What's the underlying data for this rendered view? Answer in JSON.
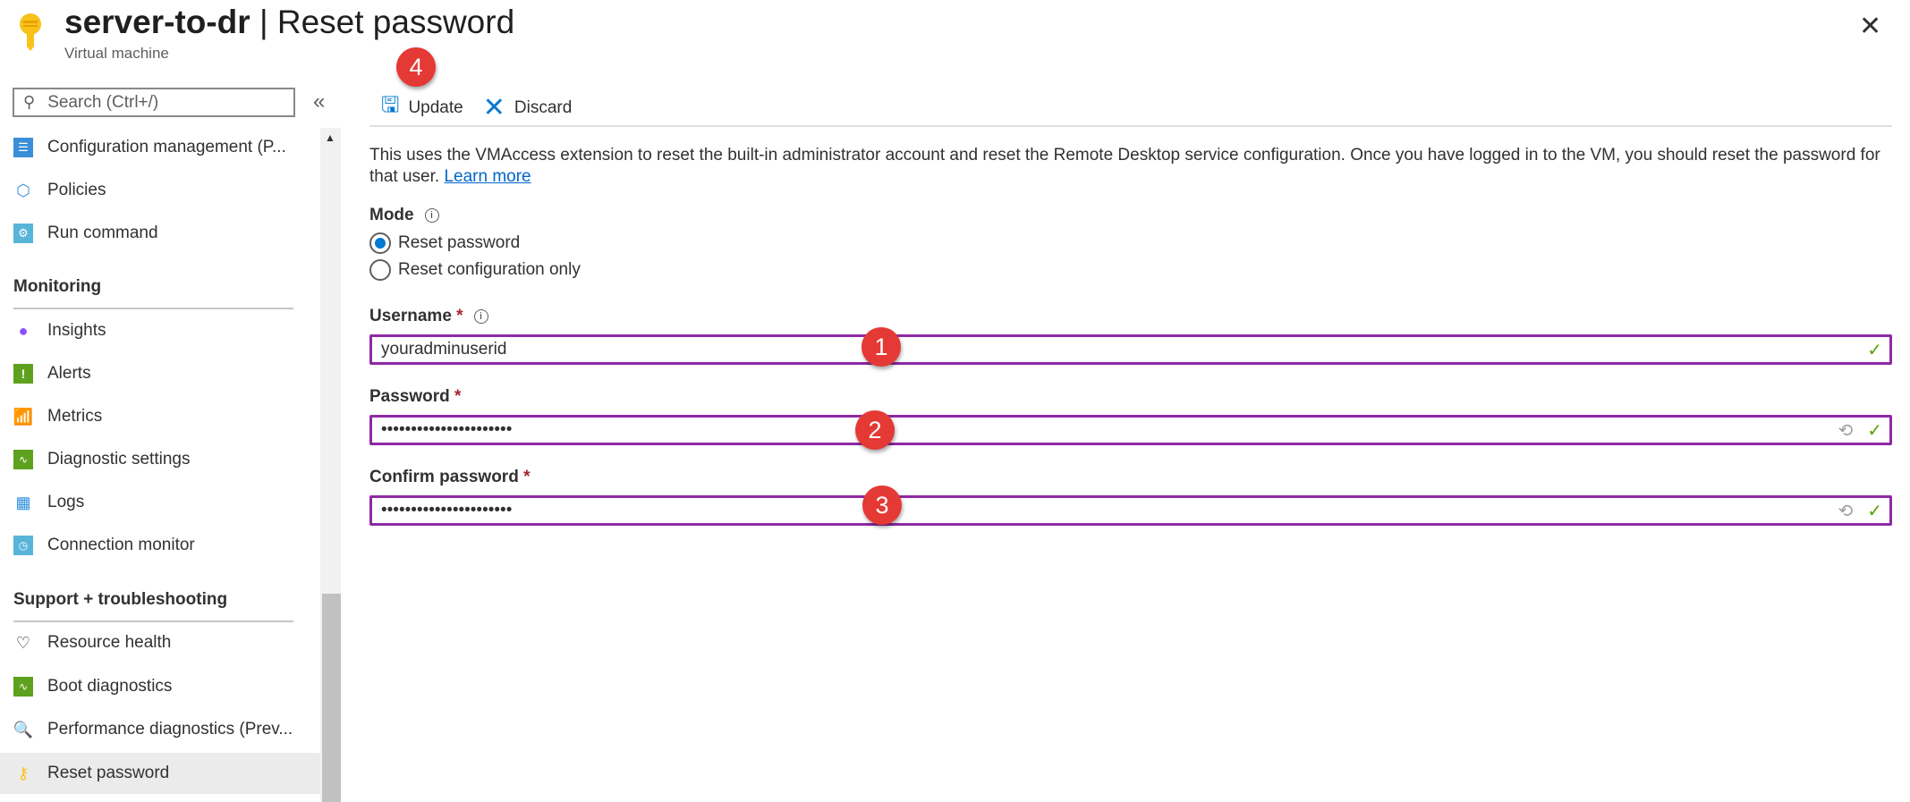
{
  "header": {
    "resource": "server-to-dr",
    "separator": "|",
    "page": "Reset password",
    "subtitle": "Virtual machine",
    "close": "✕"
  },
  "sidebar": {
    "search_placeholder": "Search (Ctrl+/)",
    "collapse": "«",
    "items_top": [
      {
        "label": "Configuration management (P..."
      },
      {
        "label": "Policies"
      },
      {
        "label": "Run command"
      }
    ],
    "monitoring": {
      "heading": "Monitoring",
      "items": [
        {
          "label": "Insights"
        },
        {
          "label": "Alerts"
        },
        {
          "label": "Metrics"
        },
        {
          "label": "Diagnostic settings"
        },
        {
          "label": "Logs"
        },
        {
          "label": "Connection monitor"
        }
      ]
    },
    "support": {
      "heading": "Support + troubleshooting",
      "items": [
        {
          "label": "Resource health"
        },
        {
          "label": "Boot diagnostics"
        },
        {
          "label": "Performance diagnostics (Prev..."
        },
        {
          "label": "Reset password",
          "selected": true
        }
      ]
    }
  },
  "toolbar": {
    "update": "Update",
    "discard": "Discard"
  },
  "description": {
    "text": "This uses the VMAccess extension to reset the built-in administrator account and reset the Remote Desktop service configuration. Once you have logged in to the VM, you should reset the password for that user.",
    "link": "Learn more"
  },
  "form": {
    "mode_label": "Mode",
    "mode_options": [
      {
        "label": "Reset password",
        "selected": true
      },
      {
        "label": "Reset configuration only",
        "selected": false
      }
    ],
    "username_label": "Username",
    "username_value": "youradminuserid",
    "password_label": "Password",
    "password_value": "••••••••••••••••••••••",
    "confirm_label": "Confirm password",
    "confirm_value": "••••••••••••••••••••••",
    "required": "*",
    "info": "i"
  },
  "badges": [
    "1",
    "2",
    "3",
    "4"
  ],
  "colors": {
    "accent": "#0078d4",
    "input_border": "#8e29a5",
    "badge": "#e53935",
    "valid": "#57a300"
  }
}
